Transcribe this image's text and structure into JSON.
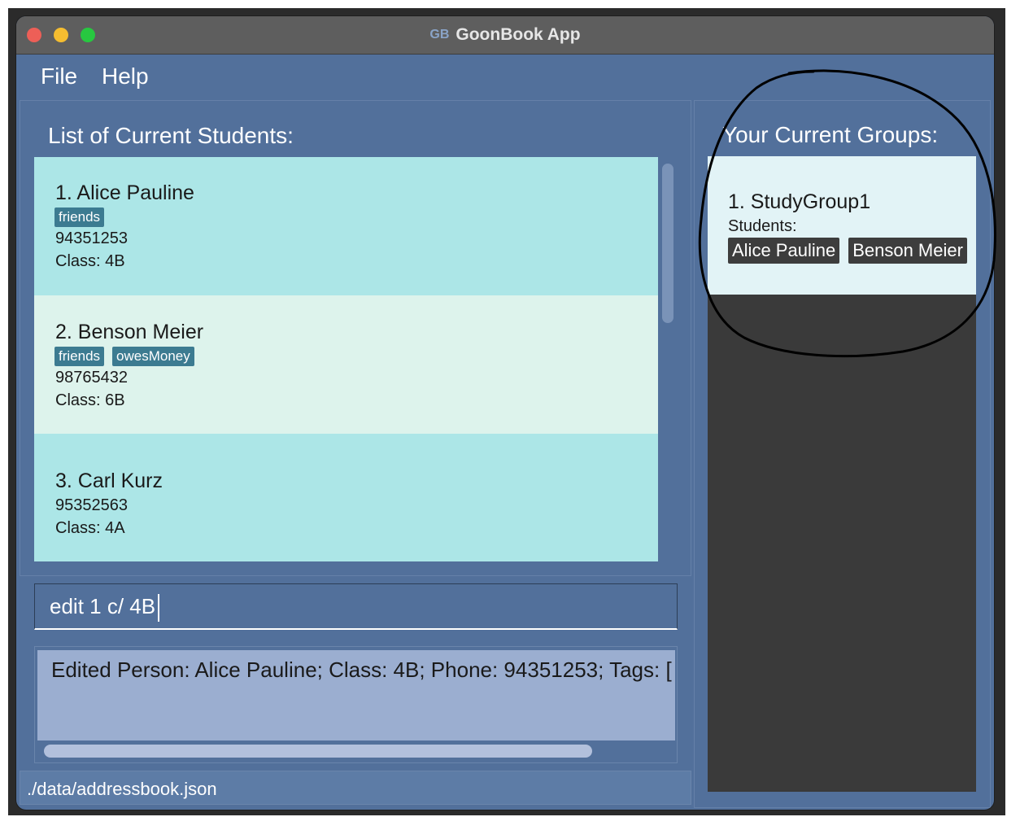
{
  "window": {
    "title": "GoonBook App"
  },
  "menu": {
    "file": "File",
    "help": "Help"
  },
  "students_panel": {
    "heading": "List of Current Students:",
    "students": [
      {
        "name": "1. Alice Pauline",
        "tags": [
          "friends"
        ],
        "phone": "94351253",
        "class": "Class: 4B"
      },
      {
        "name": "2. Benson Meier",
        "tags": [
          "friends",
          "owesMoney"
        ],
        "phone": "98765432",
        "class": "Class: 6B"
      },
      {
        "name": "3. Carl Kurz",
        "tags": [],
        "phone": "95352563",
        "class": "Class: 4A"
      }
    ]
  },
  "command_box": {
    "value": "edit 1 c/ 4B"
  },
  "result_display": {
    "text": "Edited Person: Alice Pauline; Class: 4B; Phone: 94351253; Tags: ["
  },
  "status_bar": {
    "path": "./data/addressbook.json"
  },
  "groups_panel": {
    "heading": "Your Current Groups:",
    "groups": [
      {
        "name": "1. StudyGroup1",
        "students_label": "Students:",
        "members": [
          "Alice Pauline",
          "Benson Meier"
        ]
      }
    ]
  },
  "colors": {
    "window_bg": "#52709b",
    "card_odd": "#ace6e7",
    "card_even": "#ddf3ec",
    "tag_bg": "#3c7b91",
    "member_chip_bg": "#3d3d3d",
    "group_card_bg": "#e2f3f6",
    "result_bg": "#9baed0"
  },
  "icons": {
    "app": "goonbook-logo-icon"
  }
}
